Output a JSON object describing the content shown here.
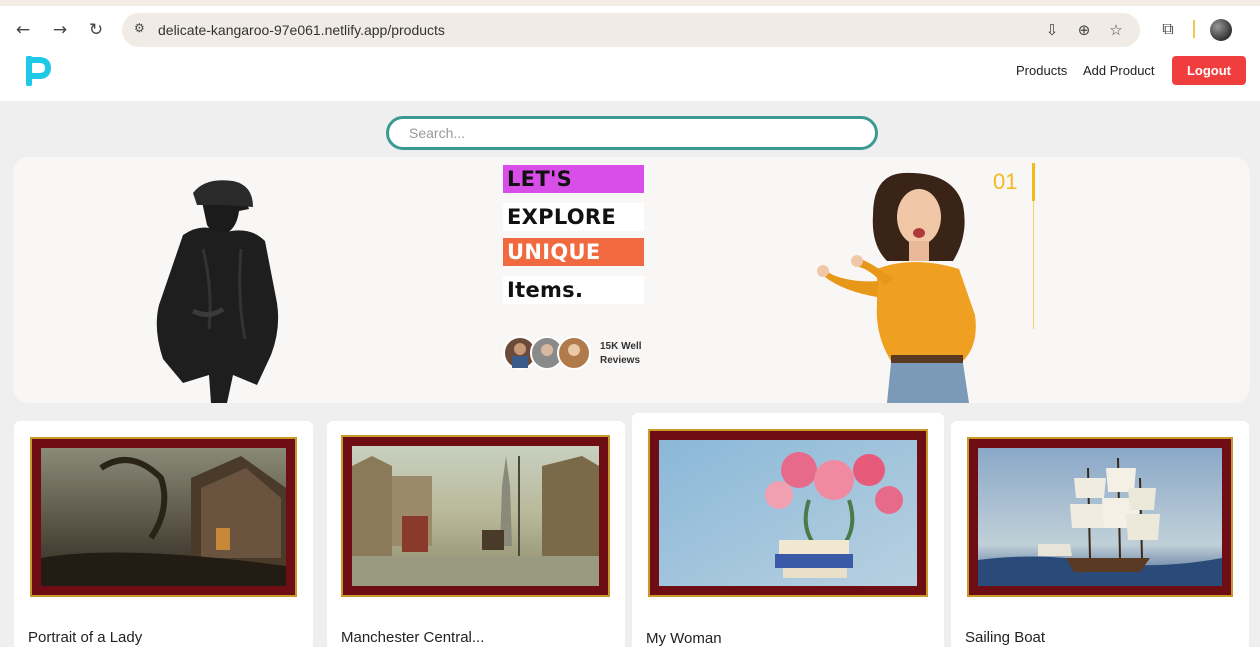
{
  "browser": {
    "url": "delicate-kangaroo-97e061.netlify.app/products",
    "colors": {
      "chrome_bg": "#ffffff",
      "omnibox_bg": "#f1ebe5"
    }
  },
  "navbar": {
    "logo_letter": "P",
    "links": [
      {
        "label": "Products"
      },
      {
        "label": "Add Product"
      }
    ],
    "logout_label": "Logout",
    "colors": {
      "logout": "#f03e3e",
      "logo": "#1ec8e8"
    }
  },
  "search": {
    "placeholder": "Search..."
  },
  "hero": {
    "tags": [
      "LET'S",
      "EXPLORE",
      "UNIQUE",
      "Items."
    ],
    "reviews_line1": "15K Well",
    "reviews_line2": "Reviews",
    "slide_number": "01",
    "colors": {
      "tag1": "#d94ee8",
      "tag3": "#f0693f",
      "accent": "#f4b91e"
    }
  },
  "products": [
    {
      "title": "Portrait of a Lady"
    },
    {
      "title": "Manchester Central..."
    },
    {
      "title": "My Woman"
    },
    {
      "title": "Sailing Boat"
    }
  ]
}
